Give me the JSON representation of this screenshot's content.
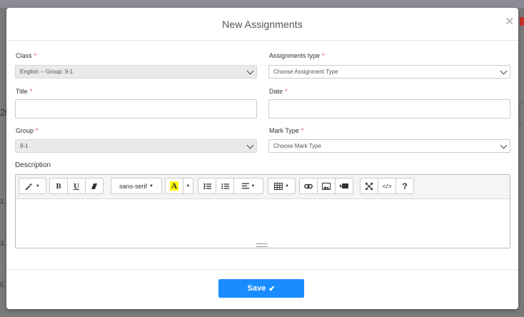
{
  "background": {
    "left_text": "20",
    "list_numbers": [
      "1.",
      "3.",
      "5."
    ]
  },
  "modal": {
    "title": "New Assignments",
    "close_symbol": "✕"
  },
  "form": {
    "class": {
      "label": "Class",
      "value": "English -- Group: 9-1"
    },
    "assignments_type": {
      "label": "Assignments type",
      "value": "Choose Assignment Type"
    },
    "title": {
      "label": "Title",
      "value": ""
    },
    "date": {
      "label": "Date",
      "value": ""
    },
    "group": {
      "label": "Group",
      "value": "9-1"
    },
    "mark_type": {
      "label": "Mark Type",
      "value": "Choose Mark Type"
    },
    "description": {
      "label": "Description"
    },
    "required_mark": "*"
  },
  "toolbar": {
    "style_icon": "magic-wand-icon",
    "bold": "B",
    "underline": "U",
    "font_family": "sans-serif",
    "text_color": "A",
    "code_view": "</>",
    "help": "?"
  },
  "footer": {
    "save_label": "Save",
    "save_icon": "✔"
  },
  "colors": {
    "primary": "#1a8cff",
    "required": "#d9534f",
    "color_highlight": "#ffff00"
  }
}
